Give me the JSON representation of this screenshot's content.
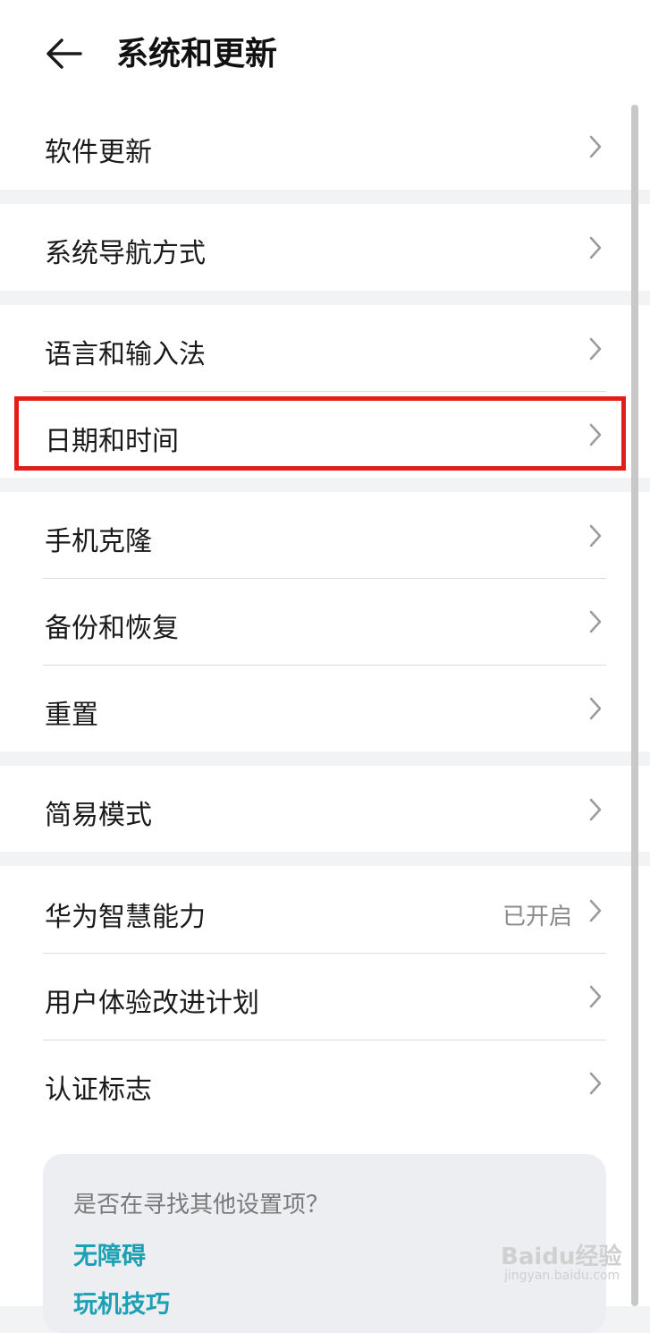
{
  "header": {
    "title": "系统和更新"
  },
  "groups": [
    {
      "items": [
        {
          "label": "软件更新"
        }
      ]
    },
    {
      "items": [
        {
          "label": "系统导航方式"
        }
      ]
    },
    {
      "items": [
        {
          "label": "语言和输入法"
        },
        {
          "label": "日期和时间"
        }
      ]
    },
    {
      "items": [
        {
          "label": "手机克隆"
        },
        {
          "label": "备份和恢复"
        },
        {
          "label": "重置"
        }
      ]
    },
    {
      "items": [
        {
          "label": "简易模式"
        }
      ]
    },
    {
      "items": [
        {
          "label": "华为智慧能力",
          "status": "已开启"
        },
        {
          "label": "用户体验改进计划"
        },
        {
          "label": "认证标志"
        }
      ]
    }
  ],
  "suggestions": {
    "title": "是否在寻找其他设置项？",
    "links": [
      "无障碍",
      "玩机技巧"
    ]
  },
  "highlighted_item": "日期和时间",
  "colors": {
    "highlight": "#e01e1e",
    "link": "#1ca0b4",
    "background": "#f1f3f5"
  },
  "watermark": {
    "text": "Baidu经验",
    "url": "jingyan.baidu.com"
  }
}
